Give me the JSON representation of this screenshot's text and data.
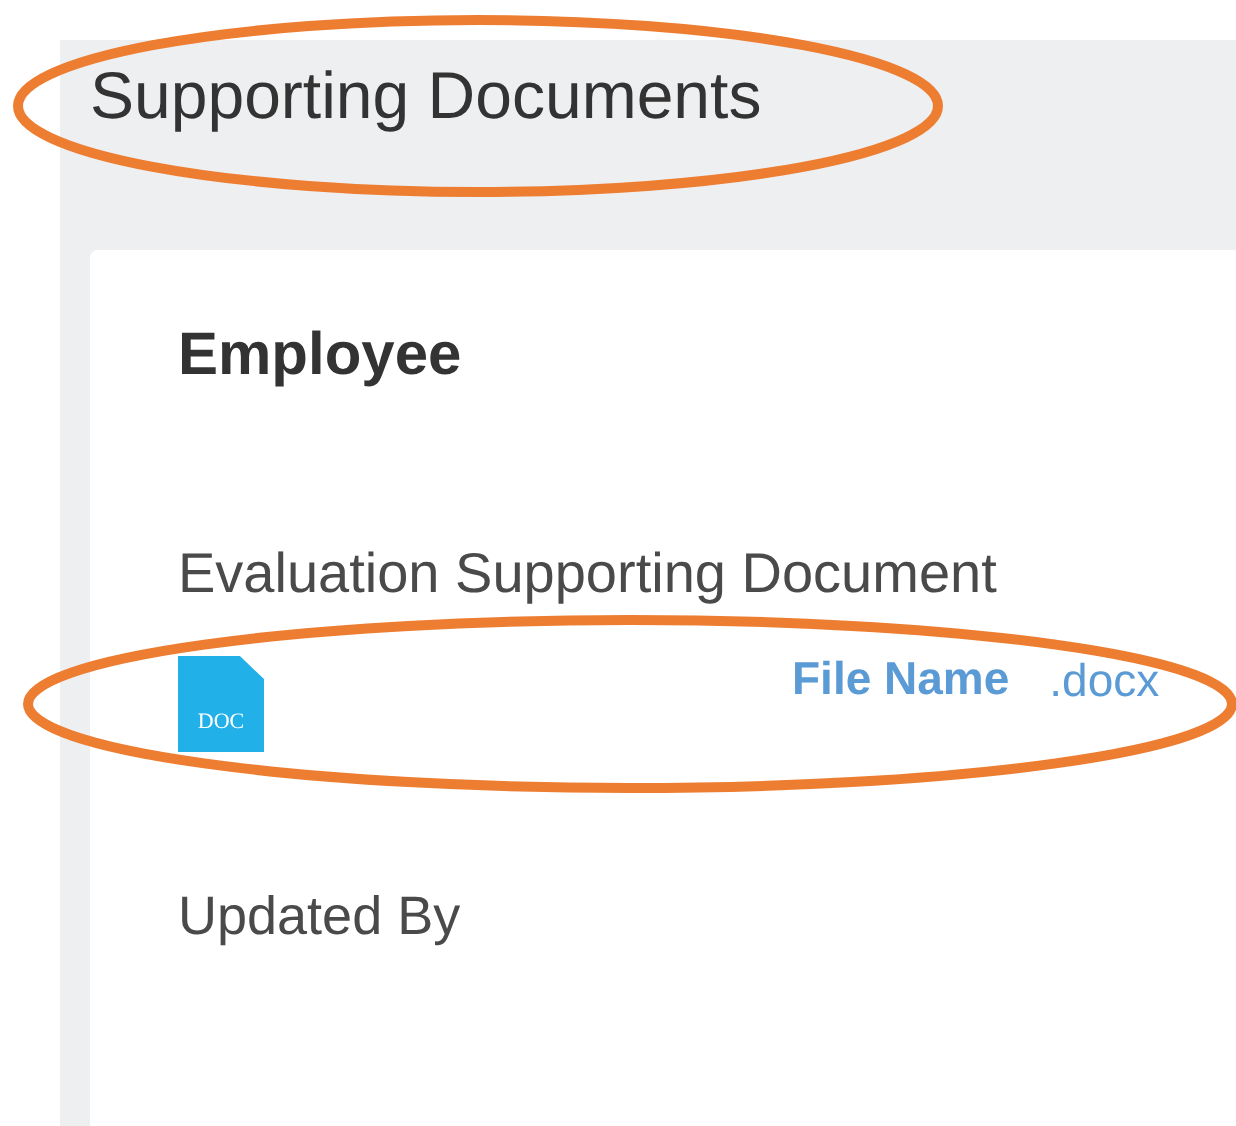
{
  "page": {
    "title": "Supporting Documents"
  },
  "card": {
    "heading": "Employee",
    "field_label": "Evaluation Supporting Document",
    "attachment": {
      "icon_text": "DOC",
      "file_name": "File Name",
      "extension": ".docx"
    },
    "updated_by_label": "Updated By"
  }
}
